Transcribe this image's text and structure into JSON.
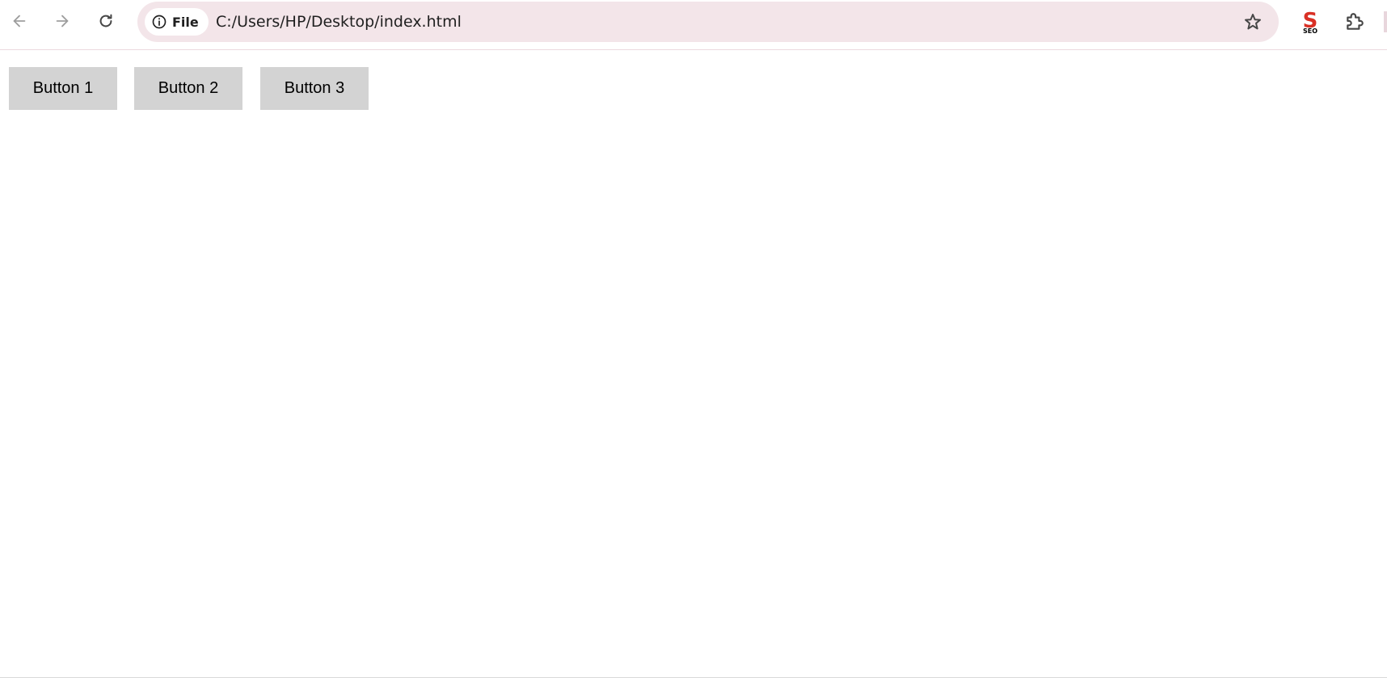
{
  "browser": {
    "icons": {
      "back": "arrow-left-icon",
      "forward": "arrow-right-icon",
      "reload": "reload-icon",
      "site_info": "info-icon",
      "bookmark": "star-icon",
      "extension_seo": "seo-extension-icon",
      "extensions_menu": "puzzle-icon"
    },
    "site_chip_label": "File",
    "url": "C:/Users/HP/Desktop/index.html",
    "seo_badge_letter": "S",
    "seo_badge_text": "SEO",
    "colors": {
      "omnibox_bg": "#f3e5e9",
      "nav_disabled": "#9e9e9e",
      "icon": "#474747",
      "seo_red": "#d93025"
    }
  },
  "page": {
    "buttons": [
      {
        "label": "Button 1"
      },
      {
        "label": "Button 2"
      },
      {
        "label": "Button 3"
      }
    ],
    "colors": {
      "button_bg": "#d3d3d3",
      "button_text": "#000000"
    }
  }
}
